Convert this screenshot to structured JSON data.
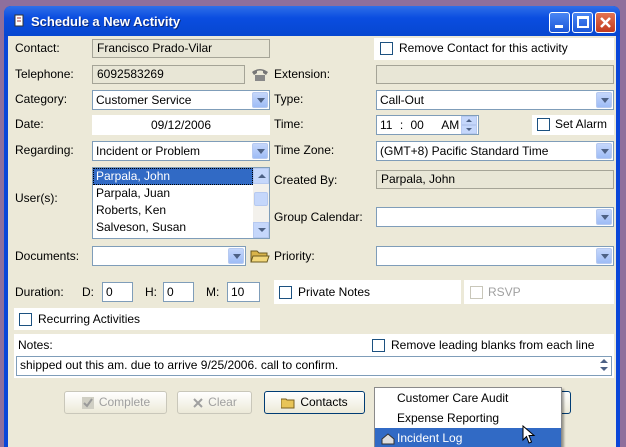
{
  "window": {
    "title": "Schedule a New Activity"
  },
  "contact": {
    "label": "Contact:",
    "value": "Francisco Prado-Vilar",
    "remove_label": "Remove Contact for this activity"
  },
  "telephone": {
    "label": "Telephone:",
    "value": "6092583269"
  },
  "extension": {
    "label": "Extension:",
    "value": ""
  },
  "category": {
    "label": "Category:",
    "value": "Customer Service"
  },
  "type": {
    "label": "Type:",
    "value": "Call-Out"
  },
  "date": {
    "label": "Date:",
    "value": "09/12/2006"
  },
  "time": {
    "label": "Time:",
    "hour": "11",
    "sep": ":",
    "minute": "00",
    "ampm": "AM",
    "alarm_label": "Set Alarm"
  },
  "regarding": {
    "label": "Regarding:",
    "value": "Incident or Problem"
  },
  "timezone": {
    "label": "Time Zone:",
    "value": "(GMT+8) Pacific Standard Time"
  },
  "users": {
    "label": "User(s):",
    "items": [
      "Parpala, John",
      "Parpala, Juan",
      "Roberts, Ken",
      "Salveson, Susan"
    ],
    "selected_index": 0
  },
  "created_by": {
    "label": "Created By:",
    "value": "Parpala, John"
  },
  "group_calendar": {
    "label": "Group Calendar:",
    "value": ""
  },
  "documents": {
    "label": "Documents:",
    "value": ""
  },
  "priority": {
    "label": "Priority:",
    "value": ""
  },
  "duration": {
    "label": "Duration:",
    "d_label": "D:",
    "d": "0",
    "h_label": "H:",
    "h": "0",
    "m_label": "M:",
    "m": "10"
  },
  "private_notes": {
    "label": "Private Notes"
  },
  "rsvp": {
    "label": "RSVP"
  },
  "recurring": {
    "label": "Recurring Activities"
  },
  "notes": {
    "label": "Notes:",
    "remove_blanks_label": "Remove leading blanks from each line",
    "value": "shipped out this am. due to arrive 9/25/2006. call to confirm."
  },
  "buttons": {
    "complete": "Complete",
    "clear": "Clear",
    "contacts": "Contacts"
  },
  "popup_menu": {
    "items": [
      "Customer Care Audit",
      "Expense Reporting",
      "Incident Log"
    ],
    "highlighted_index": 2
  },
  "colors": {
    "title_bar": "#0a4de0",
    "selection": "#316ac5",
    "dialog_bg": "#ece9d8"
  }
}
